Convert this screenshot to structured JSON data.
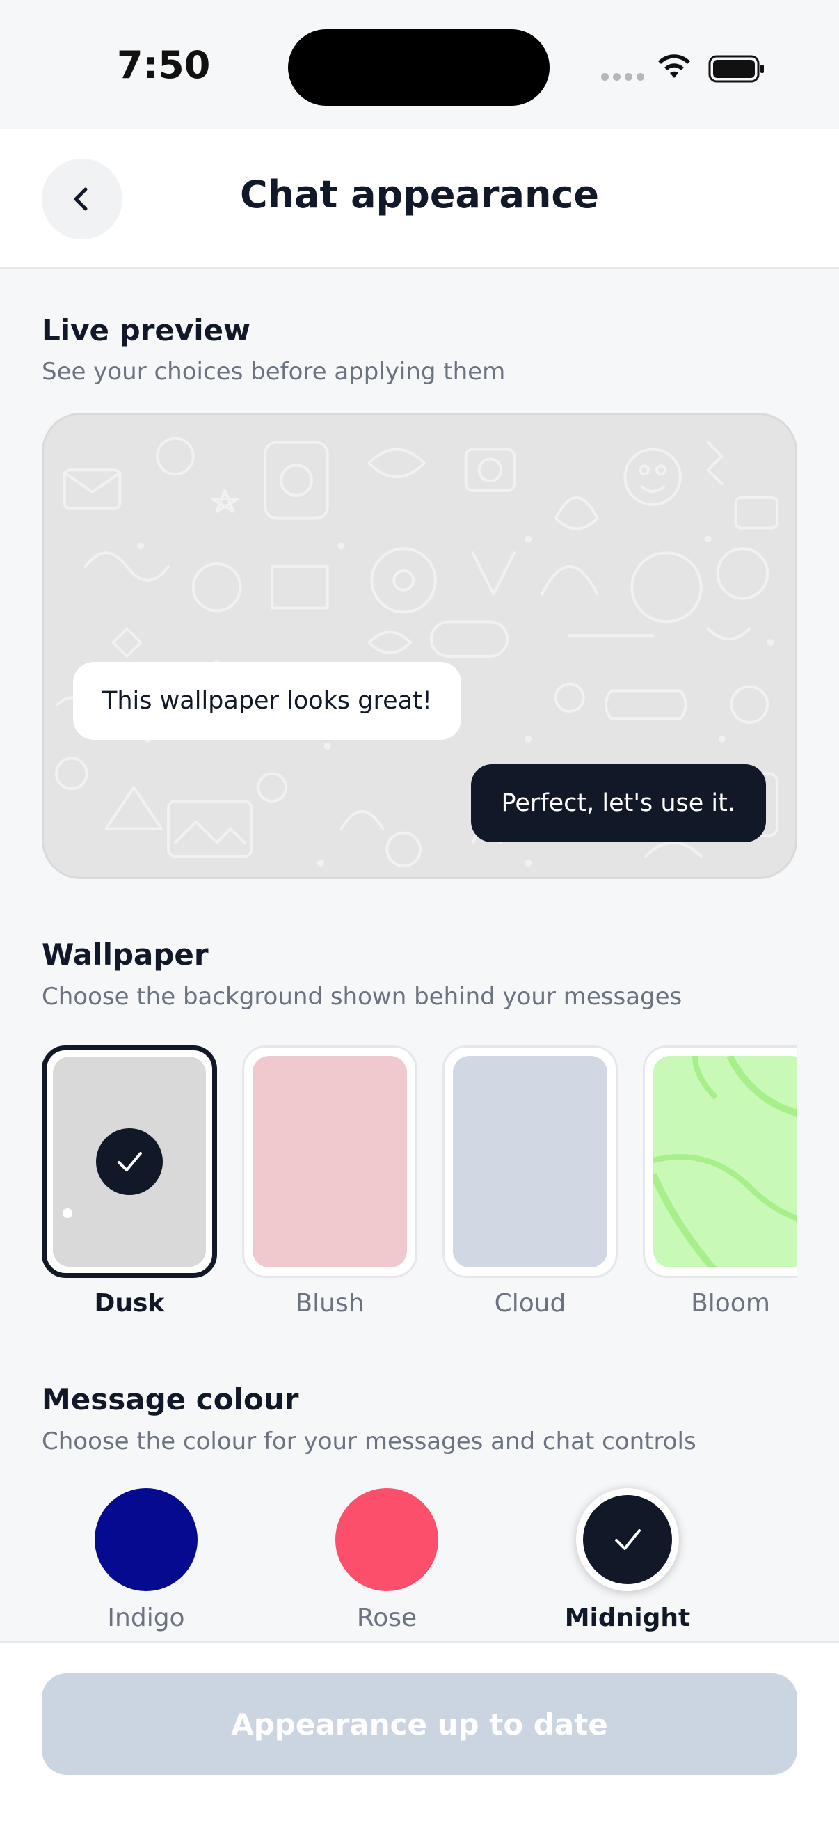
{
  "status_bar": {
    "time": "7:50"
  },
  "header": {
    "title": "Chat appearance",
    "back_icon": "chevron-left-icon"
  },
  "preview": {
    "title": "Live preview",
    "subtitle": "See your choices before applying them",
    "incoming_message": "This wallpaper looks great!",
    "outgoing_message": "Perfect, let's use it."
  },
  "wallpaper": {
    "title": "Wallpaper",
    "subtitle": "Choose the background shown behind your messages",
    "options": [
      {
        "label": "Dusk",
        "color": "#d9d9d9",
        "selected": true
      },
      {
        "label": "Blush",
        "color": "#f0c9cf",
        "selected": false
      },
      {
        "label": "Cloud",
        "color": "#cfd8e3",
        "selected": false
      },
      {
        "label": "Bloom",
        "color": "#c9f9b6",
        "selected": false
      }
    ]
  },
  "message_colour": {
    "title": "Message colour",
    "subtitle": "Choose the colour for your messages and chat controls",
    "options": [
      {
        "label": "Indigo",
        "color": "#050a8e",
        "selected": false
      },
      {
        "label": "Rose",
        "color": "#fb4f6b",
        "selected": false
      },
      {
        "label": "Midnight",
        "color": "#111827",
        "selected": true
      }
    ]
  },
  "footer": {
    "button_label": "Appearance up to date"
  },
  "colors": {
    "accent": "#111827",
    "muted_text": "#6b7280",
    "disabled_button": "#cbd5e1"
  }
}
